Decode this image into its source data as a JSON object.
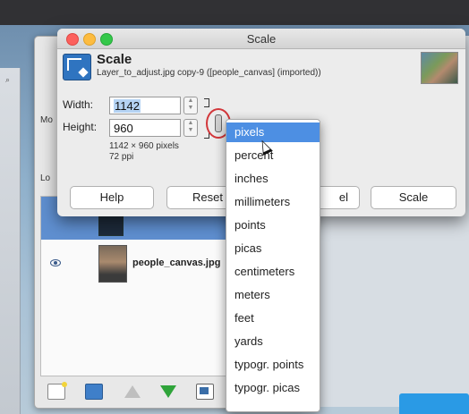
{
  "dialog": {
    "window_title": "Scale",
    "heading": "Scale",
    "subtitle": "Layer_to_adjust.jpg copy-9 ([people_canvas] (imported))",
    "width_label": "Width:",
    "width_value": "1142",
    "height_label": "Height:",
    "height_value": "960",
    "info_size": "1142 × 960 pixels",
    "info_res": "72 ppi",
    "buttons": {
      "help": "Help",
      "reset": "Reset",
      "cancel": "el",
      "scale": "Scale"
    }
  },
  "units_menu": {
    "selected": "pixels",
    "items": [
      "pixels",
      "percent",
      "inches",
      "millimeters",
      "points",
      "picas",
      "centimeters",
      "meters",
      "feet",
      "yards",
      "typogr. points",
      "typogr. picas"
    ]
  },
  "layers_panel": {
    "mode_label": "Mo",
    "lock_label": "Lo",
    "layer_name": "people_canvas.jpg"
  },
  "icons": [
    "search-icon",
    "eye-icon",
    "chain-link-icon",
    "new-layer-icon",
    "folder-icon",
    "raise-layer-icon",
    "lower-layer-icon",
    "duplicate-layer-icon",
    "mouse-cursor-icon"
  ],
  "colors": {
    "menu_highlight": "#4d8fe3",
    "chain_highlight_ring": "#d2373b",
    "traffic_close": "#fc605c",
    "traffic_min": "#fdbc40",
    "traffic_max": "#34c84a"
  }
}
